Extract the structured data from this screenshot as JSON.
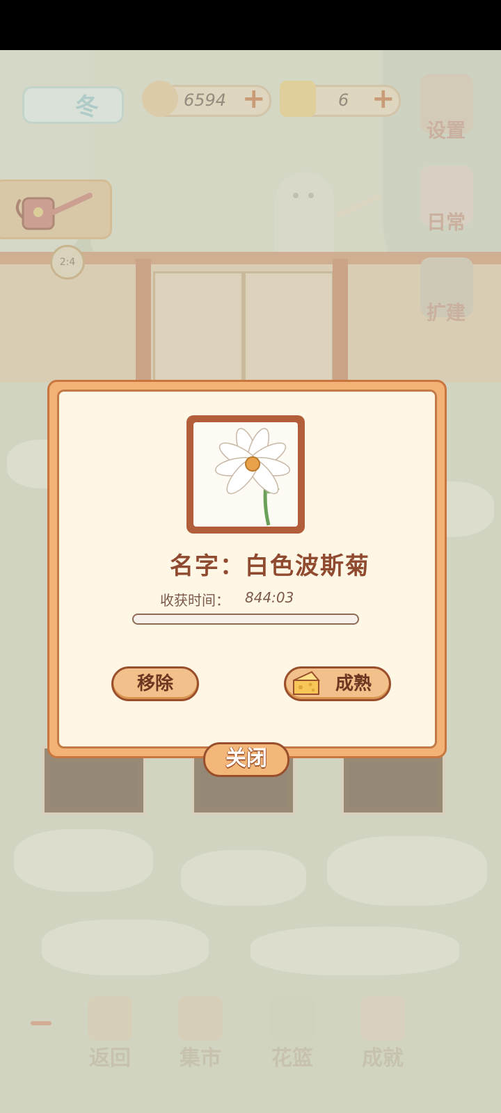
{
  "hud": {
    "season_label": "冬",
    "coins": "6594",
    "cheese": "6",
    "settings_label": "设置",
    "daily_label": "日常",
    "expand_label": "扩建",
    "clock_time": "2:4"
  },
  "nav": {
    "back_label": "返回",
    "market_label": "集市",
    "basket_label": "花篮",
    "achievement_label": "成就"
  },
  "dialog": {
    "name_line": "名字：白色波斯菊",
    "harvest_label": "收获时间：",
    "harvest_value": "844:03",
    "progress": 0.0,
    "remove_label": "移除",
    "mature_label": "成熟",
    "close_label": "关闭"
  },
  "colors": {
    "dialog_border": "#f3b276",
    "dialog_bg": "#fef7e5",
    "button_fill": "#f2c08a",
    "text_brown": "#8f4a2f"
  },
  "icons": [
    "fishbone-icon",
    "cheese-icon",
    "gear-icon",
    "notepad-icon",
    "hammer-icon",
    "watering-can-icon",
    "clock-icon",
    "window-icon",
    "market-stall-icon",
    "basket-icon",
    "trophy-icon",
    "cosmos-flower-icon"
  ]
}
